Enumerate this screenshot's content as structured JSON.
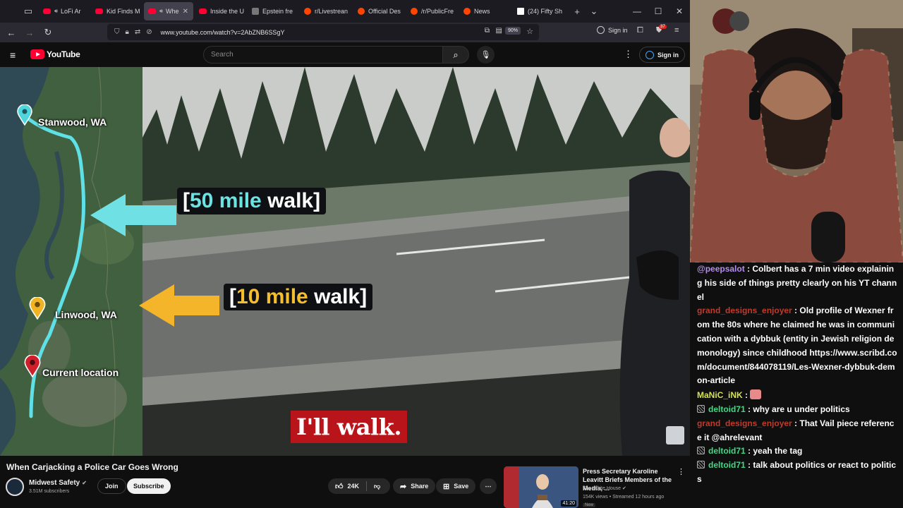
{
  "browser": {
    "tabs": [
      {
        "label": "LoFi Ar",
        "fav": "yt",
        "speaker": true
      },
      {
        "label": "Kid Finds M",
        "fav": "yt"
      },
      {
        "label": "Whe",
        "fav": "yt",
        "speaker": true,
        "active": true
      },
      {
        "label": "Inside the U",
        "fav": "yt"
      },
      {
        "label": "Epstein fre",
        "fav": "ep"
      },
      {
        "label": "r/Livestrean",
        "fav": "reddit"
      },
      {
        "label": "Official Des",
        "fav": "reddit"
      },
      {
        "label": "/r/PublicFre",
        "fav": "reddit"
      },
      {
        "label": "News",
        "fav": "reddit"
      },
      {
        "label": "(24) Fifty Sh",
        "fav": "x"
      }
    ],
    "url": "www.youtube.com/watch?v=2AbZNB6SSgY",
    "zoom": "90%",
    "signin_label": "Sign in",
    "extension_badge": "37"
  },
  "youtube": {
    "logo_text": "YouTube",
    "search_placeholder": "Search",
    "signin_label": "Sign in",
    "video": {
      "map": {
        "labels": {
          "stanwood": "Stanwood, WA",
          "linwood": "Linwood, WA",
          "current": "Current location"
        }
      },
      "callouts": {
        "walk50": {
          "open": "[",
          "num": "50 mile",
          "rest": " walk]"
        },
        "walk10": {
          "open": "[",
          "num": "10 mile",
          "rest": " walk]"
        }
      },
      "subtitle": "I'll walk."
    },
    "title": "When Carjacking a Police Car Goes Wrong",
    "channel": {
      "name": "Midwest Safety",
      "subscribers": "3.51M subscribers"
    },
    "buttons": {
      "join": "Join",
      "subscribe": "Subscribe",
      "likes": "24K",
      "share": "Share",
      "save": "Save"
    },
    "recommended": {
      "title": "Press Secretary Karoline Leavitt Briefs Members of the Media, ...",
      "channel": "The White House",
      "meta": "154K views • Streamed 12 hours ago",
      "duration": "41:20",
      "badge": "New"
    }
  },
  "chat": {
    "messages": [
      {
        "user": "@peepsalot",
        "color": "#b68cf0",
        "mod": false,
        "text": "Colbert has a 7 min video explaining his side of things pretty clearly on his YT channel"
      },
      {
        "user": "grand_designs_enjoyer",
        "color": "#c0392b",
        "mod": false,
        "text": "Old profile of Wexner from the 80s where he claimed he was in communication with a dybbuk (entity in Jewish religion demonology) since childhood https://www.scribd.com/document/844078119/Les-Wexner-dybbuk-demon-article"
      },
      {
        "user": "MaNiC_iNK",
        "color": "#d4e157",
        "mod": false,
        "text": "",
        "emote": true
      },
      {
        "user": "deltoid71",
        "color": "#3ddc84",
        "mod": true,
        "text": "why are u under politics"
      },
      {
        "user": "grand_designs_enjoyer",
        "color": "#c0392b",
        "mod": false,
        "text": "That Vail piece reference it @ahrelevant"
      },
      {
        "user": "deltoid71",
        "color": "#3ddc84",
        "mod": true,
        "text": "yeah the tag"
      },
      {
        "user": "deltoid71",
        "color": "#3ddc84",
        "mod": true,
        "text": "talk about politics or react to politics"
      }
    ]
  }
}
